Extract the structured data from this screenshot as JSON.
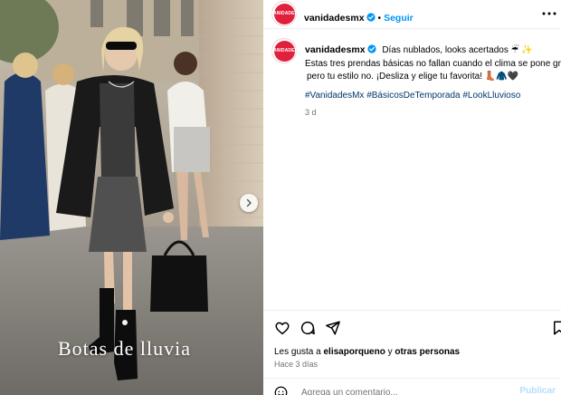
{
  "post": {
    "username": "vanidadesmx",
    "follow_label": "Seguir",
    "separator": "•",
    "avatar_text": "VANIDADES",
    "caption_line1": "Días nublados, looks acertados ☔ ✨",
    "caption_line2": "Estas tres prendas básicas no fallan cuando el clima se pone gris,",
    "caption_line3": "pero tu estilo no. ¡Desliza y elige tu favorita! 👢🧥🖤",
    "hashtags": "#VanidadesMx #BásicosDeTemporada #LookLluvioso",
    "age": "3 d"
  },
  "media": {
    "overlay_text": "Botas de lluvia"
  },
  "engagement": {
    "likes_prefix": "Les gusta a ",
    "likes_user": "elisaporqueno",
    "likes_mid": " y ",
    "likes_others": "otras personas",
    "date": "Hace 3 días"
  },
  "comment": {
    "placeholder": "Agrega un comentario...",
    "publish_label": "Publicar"
  },
  "colors": {
    "brand": "#e0203d",
    "link": "#0095f6",
    "hashtag": "#00376b",
    "verified": "#0095f6"
  },
  "icons": [
    "verified-icon",
    "more-icon",
    "heart-icon",
    "comment-icon",
    "share-icon",
    "bookmark-icon",
    "emoji-icon",
    "chevron-right-icon"
  ]
}
